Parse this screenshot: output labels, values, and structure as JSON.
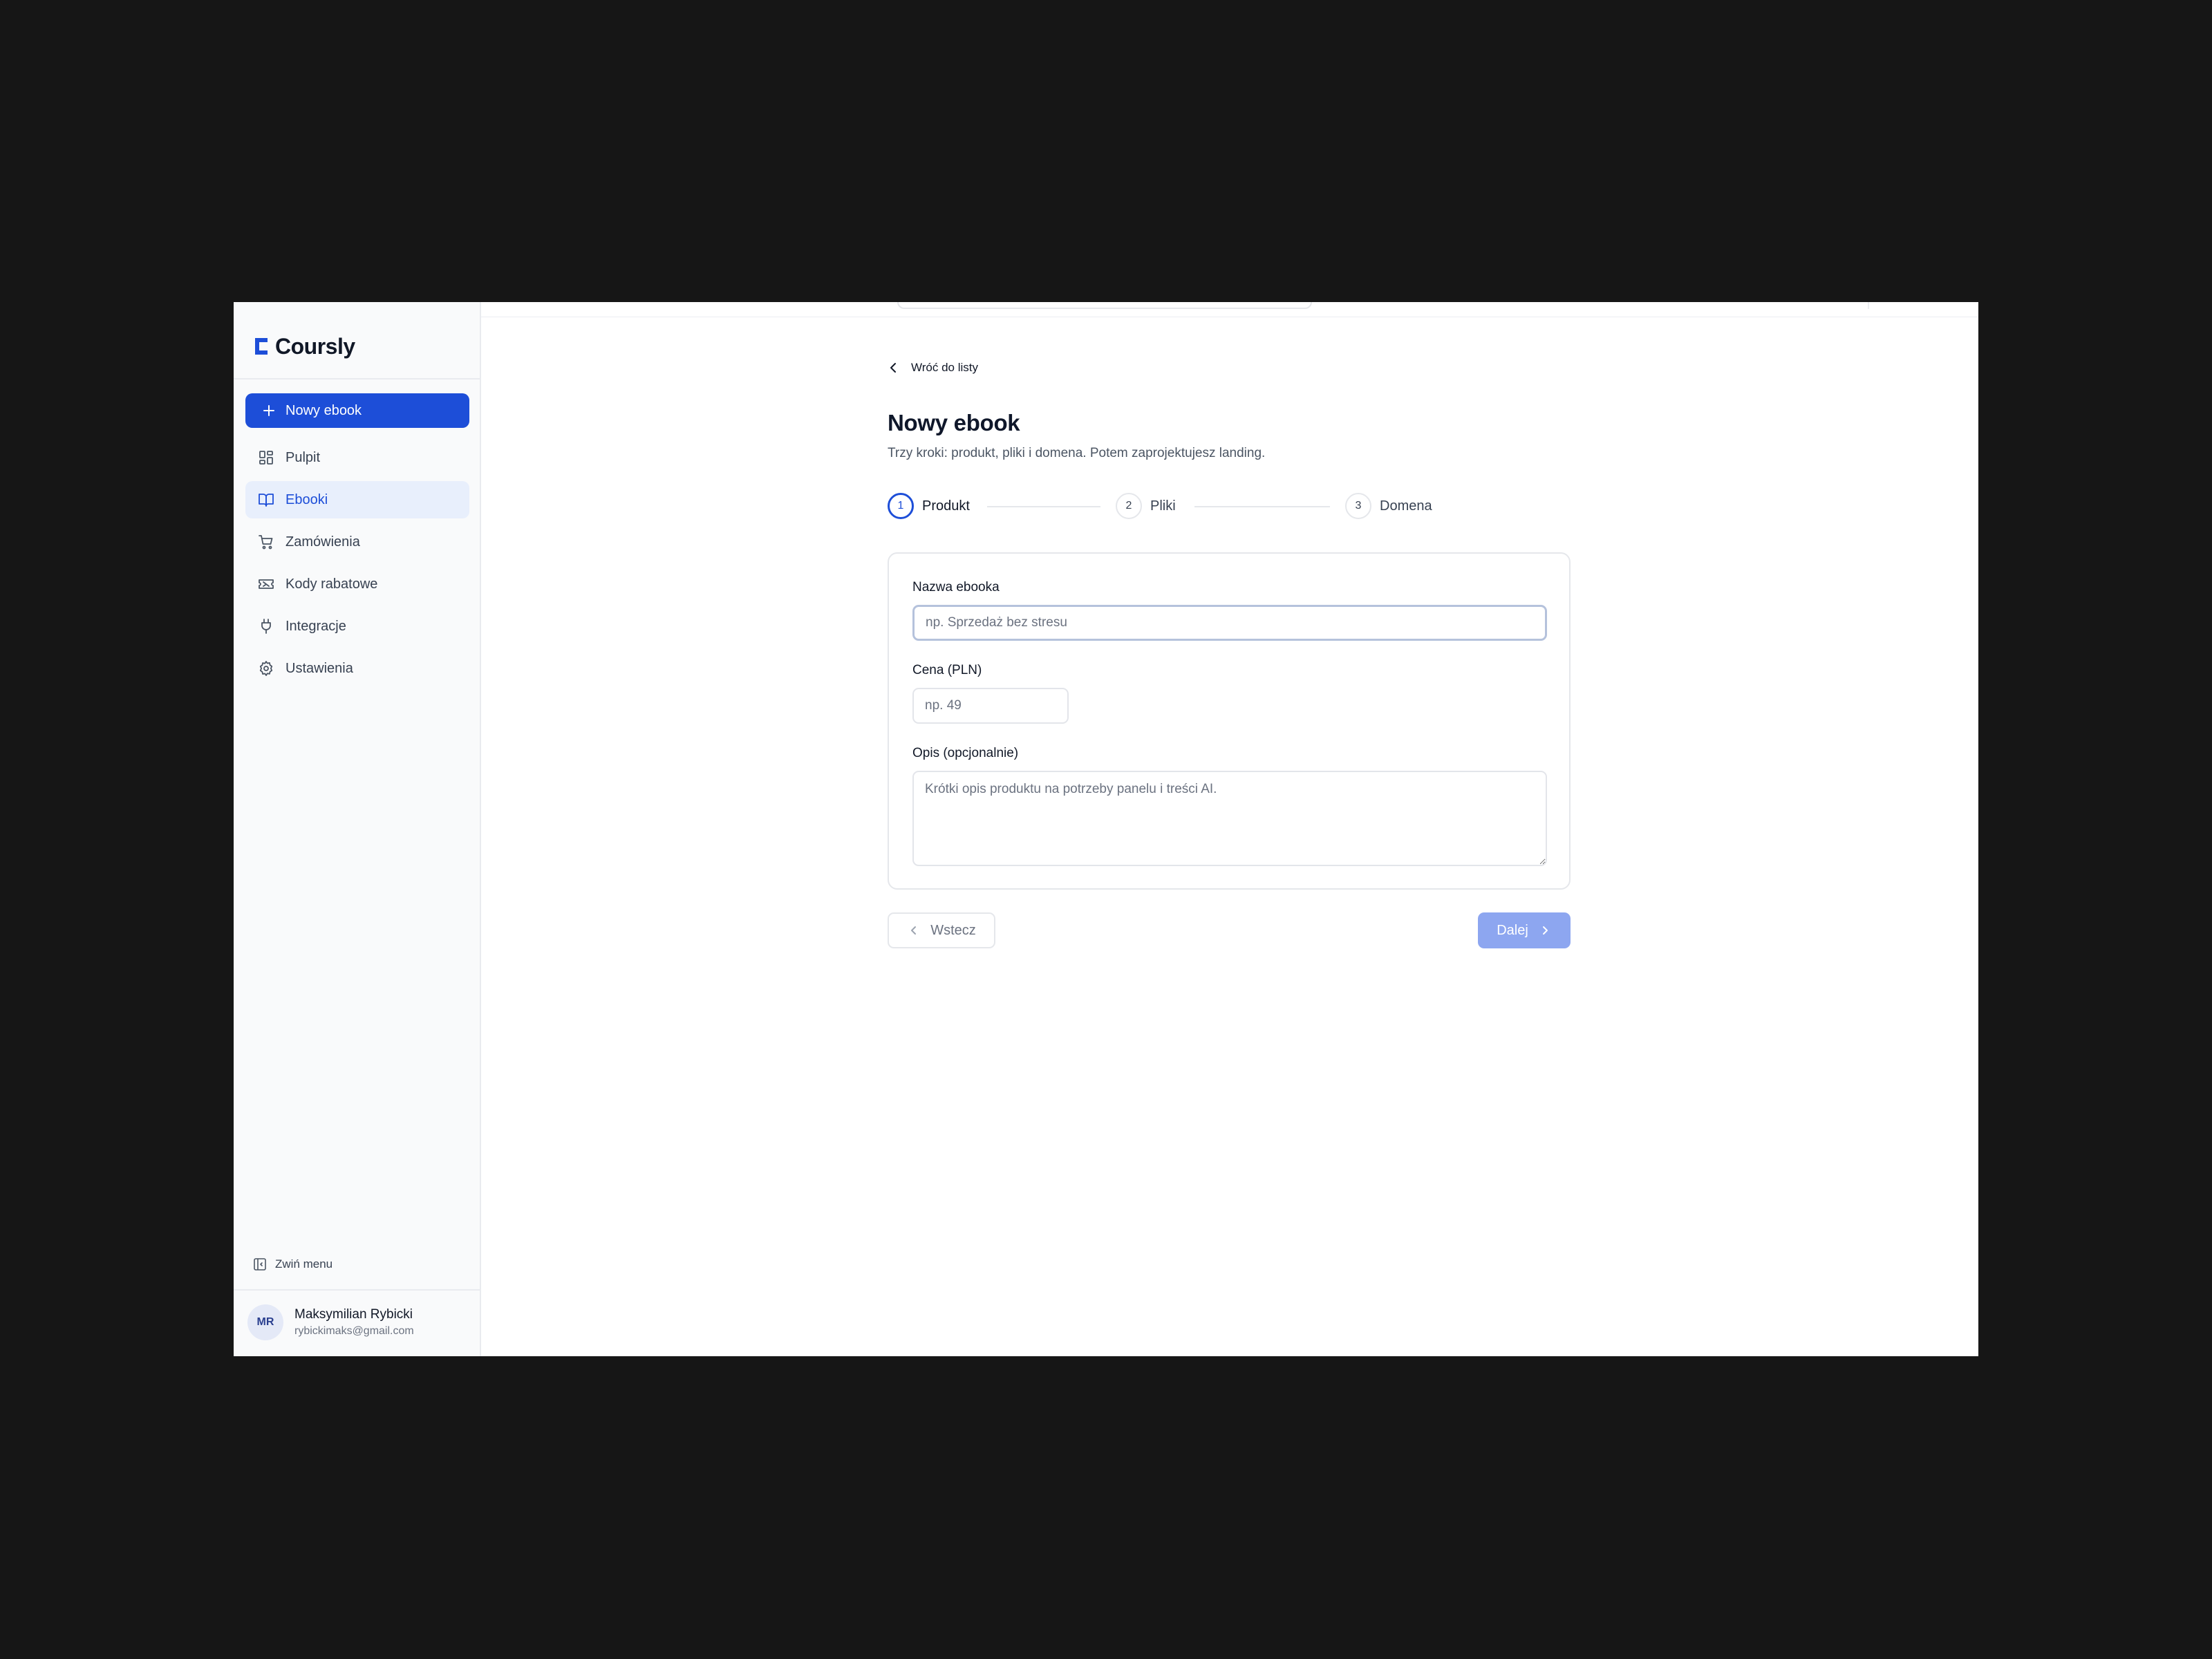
{
  "brand": {
    "name": "Coursly",
    "accent": "#1d4ed8"
  },
  "sidebar": {
    "new_button": "Nowy ebook",
    "items": [
      {
        "label": "Pulpit",
        "icon": "dashboard-icon",
        "active": false
      },
      {
        "label": "Ebooki",
        "icon": "book-open-icon",
        "active": true
      },
      {
        "label": "Zamówienia",
        "icon": "cart-icon",
        "active": false
      },
      {
        "label": "Kody rabatowe",
        "icon": "ticket-icon",
        "active": false
      },
      {
        "label": "Integracje",
        "icon": "plug-icon",
        "active": false
      },
      {
        "label": "Ustawienia",
        "icon": "gear-icon",
        "active": false
      }
    ],
    "collapse_label": "Zwiń menu"
  },
  "user": {
    "initials": "MR",
    "name": "Maksymilian Rybicki",
    "email": "rybickimaks@gmail.com"
  },
  "main": {
    "back_link": "Wróć do listy",
    "title": "Nowy ebook",
    "subtitle": "Trzy kroki: produkt, pliki i domena. Potem zaprojektujesz landing.",
    "steps": [
      {
        "number": "1",
        "label": "Produkt",
        "active": true
      },
      {
        "number": "2",
        "label": "Pliki",
        "active": false
      },
      {
        "number": "3",
        "label": "Domena",
        "active": false
      }
    ],
    "form": {
      "name_label": "Nazwa ebooka",
      "name_placeholder": "np. Sprzedaż bez stresu",
      "price_label": "Cena (PLN)",
      "price_placeholder": "np. 49",
      "description_label": "Opis (opcjonalnie)",
      "description_placeholder": "Krótki opis produktu na potrzeby panelu i treści AI."
    },
    "buttons": {
      "back": "Wstecz",
      "next": "Dalej"
    }
  }
}
